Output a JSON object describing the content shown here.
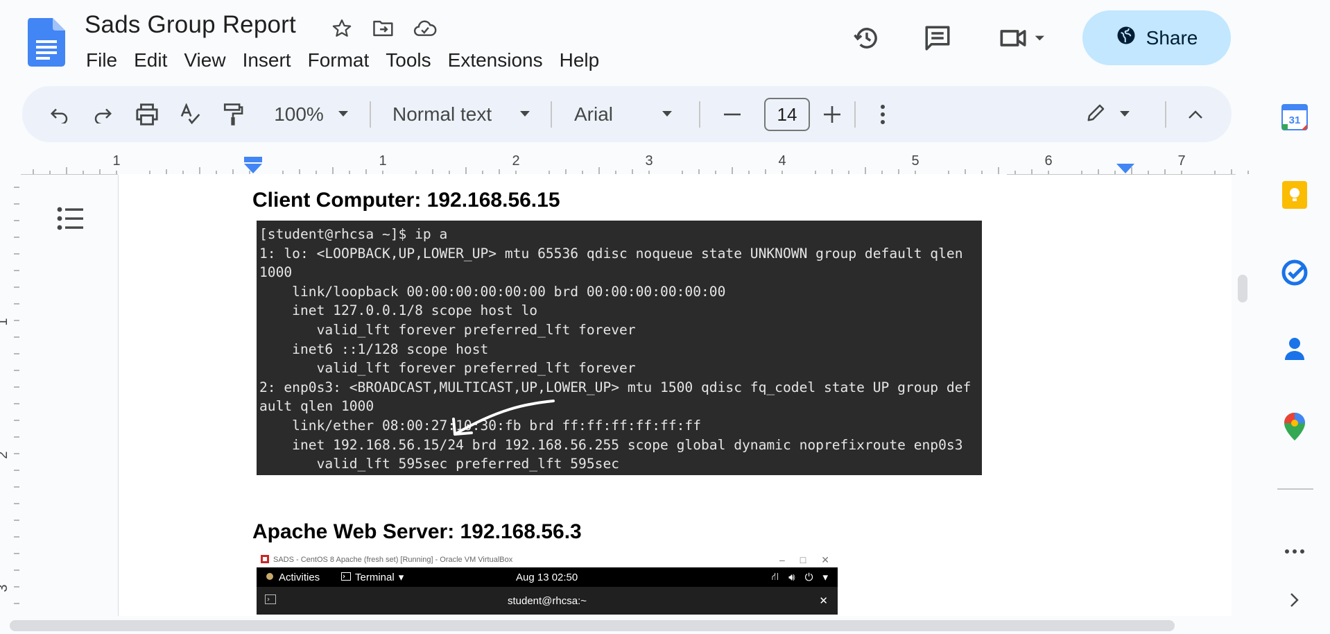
{
  "app": {
    "doc_title": "Sads Group Report"
  },
  "menu": [
    "File",
    "Edit",
    "View",
    "Insert",
    "Format",
    "Tools",
    "Extensions",
    "Help"
  ],
  "header": {
    "share_label": "Share",
    "icons": [
      "star-icon",
      "move-folder-icon",
      "cloud-status-icon",
      "version-history-icon",
      "comments-icon",
      "meet-icon"
    ]
  },
  "toolbar": {
    "zoom": "100%",
    "style": "Normal text",
    "font": "Arial",
    "font_size": "14"
  },
  "ruler": {
    "h_labels": [
      "1",
      "1",
      "2",
      "3",
      "4",
      "5",
      "6",
      "7"
    ],
    "v_labels": [
      "1",
      "2",
      "3"
    ]
  },
  "document": {
    "heading1": "Client Computer: 192.168.56.15",
    "terminal_lines": [
      "[student@rhcsa ~]$ ip a",
      "1: lo: <LOOPBACK,UP,LOWER_UP> mtu 65536 qdisc noqueue state UNKNOWN group default qlen",
      "1000",
      "    link/loopback 00:00:00:00:00:00 brd 00:00:00:00:00:00",
      "    inet 127.0.0.1/8 scope host lo",
      "       valid_lft forever preferred_lft forever",
      "    inet6 ::1/128 scope host",
      "       valid_lft forever preferred_lft forever",
      "2: enp0s3: <BROADCAST,MULTICAST,UP,LOWER_UP> mtu 1500 qdisc fq_codel state UP group def",
      "ault qlen 1000",
      "    link/ether 08:00:27:10:30:fb brd ff:ff:ff:ff:ff:ff",
      "    inet 192.168.56.15/24 brd 192.168.56.255 scope global dynamic noprefixroute enp0s3",
      "       valid_lft 595sec preferred_lft 595sec"
    ],
    "heading2": "Apache Web Server: 192.168.56.3",
    "vbox": {
      "window_title": "SADS - CentOS 8 Apache (fresh set) [Running] - Oracle VM VirtualBox",
      "activities": "Activities",
      "terminal_menu": "Terminal",
      "clock": "Aug 13  02:50",
      "term_title": "student@rhcsa:~"
    }
  },
  "side_panel": {
    "calendar_day": "31"
  },
  "colors": {
    "share_bg": "#c2e7ff",
    "toolbar_bg": "#edf2fa",
    "docs_blue": "#4285f4",
    "terminal_bg": "#2b2b2b"
  }
}
